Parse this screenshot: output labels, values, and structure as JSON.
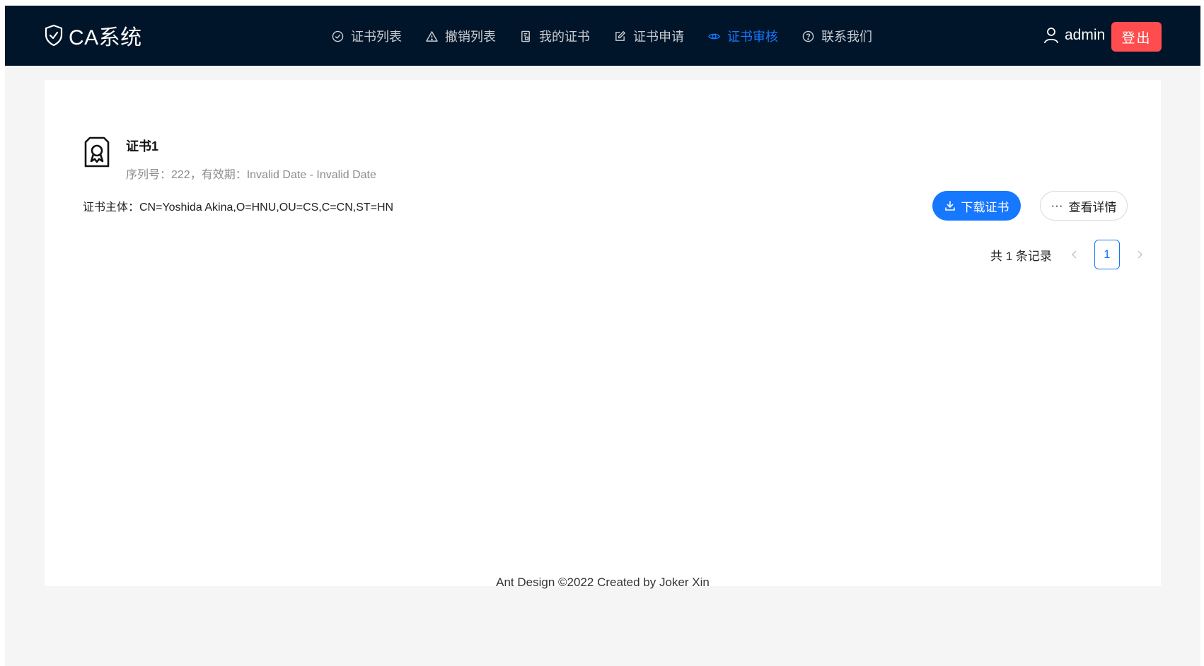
{
  "app": {
    "title": "CA系统",
    "logo_icon": "shield-check-icon"
  },
  "nav": {
    "items": [
      {
        "label": "证书列表",
        "icon": "check-circle-icon",
        "active": false
      },
      {
        "label": "撤销列表",
        "icon": "warning-icon",
        "active": false
      },
      {
        "label": "我的证书",
        "icon": "file-protect-icon",
        "active": false
      },
      {
        "label": "证书申请",
        "icon": "edit-icon",
        "active": false
      },
      {
        "label": "证书审核",
        "icon": "eye-icon",
        "active": true
      },
      {
        "label": "联系我们",
        "icon": "question-circle-icon",
        "active": false
      }
    ]
  },
  "user": {
    "name": "admin",
    "logout_label": "登出",
    "icon": "user-icon"
  },
  "certificate": {
    "title": "证书1",
    "description": "序列号：222，有效期：Invalid Date - Invalid Date",
    "subject": "证书主体：CN=Yoshida Akina,O=HNU,OU=CS,C=CN,ST=HN",
    "download_label": "下载证书",
    "detail_label": "查看详情",
    "icon": "certificate-icon"
  },
  "pagination": {
    "total_text": "共 1 条记录",
    "current_page": "1"
  },
  "footer": {
    "text": "Ant Design ©2022 Created by Joker Xin"
  },
  "colors": {
    "header_bg": "#001529",
    "primary": "#1677ff",
    "danger": "#ff4d4f",
    "page_bg": "#f5f5f5"
  }
}
